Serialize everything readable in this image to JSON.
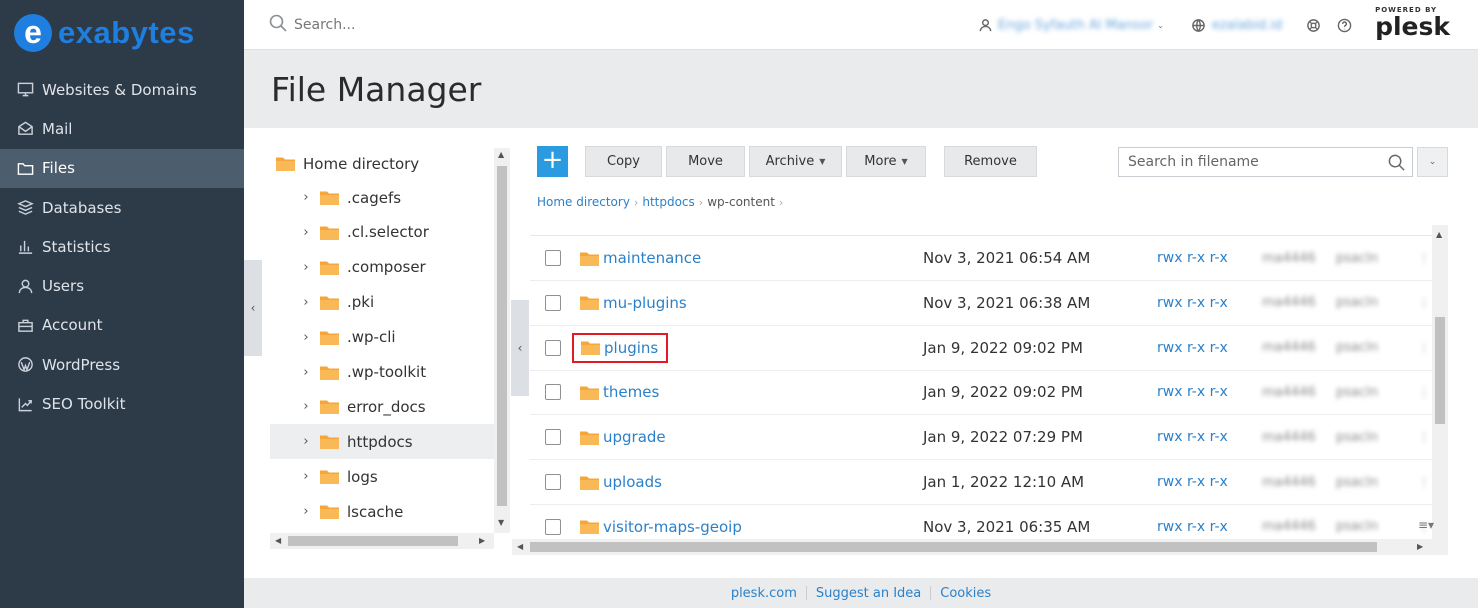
{
  "brand": {
    "logo_letter": "e",
    "logo_text": "exabytes"
  },
  "sidebar": {
    "items": [
      {
        "label": "Websites & Domains",
        "icon": "monitor-icon"
      },
      {
        "label": "Mail",
        "icon": "mail-icon"
      },
      {
        "label": "Files",
        "icon": "folder-icon",
        "active": true
      },
      {
        "label": "Databases",
        "icon": "database-icon"
      },
      {
        "label": "Statistics",
        "icon": "bar-chart-icon"
      },
      {
        "label": "Users",
        "icon": "user-icon"
      },
      {
        "label": "Account",
        "icon": "briefcase-icon"
      },
      {
        "label": "WordPress",
        "icon": "wordpress-icon"
      },
      {
        "label": "SEO Toolkit",
        "icon": "seo-chart-icon"
      }
    ]
  },
  "topbar": {
    "search_placeholder": "Search...",
    "user_name": "Engo Syfauth Al Mansor",
    "subscription": "ezalabid.id",
    "powered_by": "POWERED BY",
    "plesk": "plesk"
  },
  "page": {
    "title": "File Manager"
  },
  "tree": {
    "root": "Home directory",
    "items": [
      ".cagefs",
      ".cl.selector",
      ".composer",
      ".pki",
      ".wp-cli",
      ".wp-toolkit",
      "error_docs",
      "httpdocs",
      "logs",
      "lscache"
    ],
    "selected": "httpdocs"
  },
  "toolbar": {
    "add": "+",
    "copy": "Copy",
    "move": "Move",
    "archive": "Archive",
    "more": "More",
    "remove": "Remove",
    "search_placeholder": "Search in filename"
  },
  "breadcrumb": [
    "Home directory",
    "httpdocs",
    "wp-content"
  ],
  "files": [
    {
      "name": "maintenance",
      "date": "Nov 3, 2021 06:54 AM",
      "perm": "rwx r-x r-x",
      "owner": "ma4446",
      "group": "psacln"
    },
    {
      "name": "mu-plugins",
      "date": "Nov 3, 2021 06:38 AM",
      "perm": "rwx r-x r-x",
      "owner": "ma4446",
      "group": "psacln"
    },
    {
      "name": "plugins",
      "date": "Jan 9, 2022 09:02 PM",
      "perm": "rwx r-x r-x",
      "owner": "ma4446",
      "group": "psacln",
      "highlighted": true
    },
    {
      "name": "themes",
      "date": "Jan 9, 2022 09:02 PM",
      "perm": "rwx r-x r-x",
      "owner": "ma4446",
      "group": "psacln"
    },
    {
      "name": "upgrade",
      "date": "Jan 9, 2022 07:29 PM",
      "perm": "rwx r-x r-x",
      "owner": "ma4446",
      "group": "psacln"
    },
    {
      "name": "uploads",
      "date": "Jan 1, 2022 12:10 AM",
      "perm": "rwx r-x r-x",
      "owner": "ma4446",
      "group": "psacln"
    },
    {
      "name": "visitor-maps-geoip",
      "date": "Nov 3, 2021 06:35 AM",
      "perm": "rwx r-x r-x",
      "owner": "ma4446",
      "group": "psacln"
    }
  ],
  "footer": {
    "links": [
      "plesk.com",
      "Suggest an Idea",
      "Cookies"
    ]
  },
  "colors": {
    "sidebar_bg": "#2d3a47",
    "accent": "#2a9be0",
    "link": "#2b81c9",
    "highlight_border": "#e01b24",
    "folder": "#f5a53a"
  }
}
